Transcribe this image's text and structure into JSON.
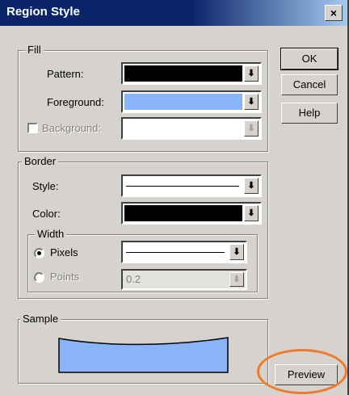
{
  "window": {
    "title": "Region Style",
    "close_glyph": "×"
  },
  "buttons": {
    "ok": "OK",
    "cancel": "Cancel",
    "help": "Help",
    "preview": "Preview"
  },
  "fill": {
    "group_label": "Fill",
    "pattern_label": "Pattern:",
    "pattern_color": "#000000",
    "foreground_label": "Foreground:",
    "foreground_color": "#8ab4f8",
    "background_label": "Background:",
    "background_checked": false,
    "background_color": "#ffffff"
  },
  "border": {
    "group_label": "Border",
    "style_label": "Style:",
    "color_label": "Color:",
    "color_value": "#000000",
    "width": {
      "group_label": "Width",
      "pixels_label": "Pixels",
      "points_label": "Points",
      "selected": "pixels",
      "points_value": "0.2"
    }
  },
  "sample": {
    "group_label": "Sample",
    "fill_color": "#8ab4f8"
  },
  "icons": {
    "dropdown_arrow": "⬇"
  },
  "colors": {
    "title_bar": "#0a246a",
    "dialog_bg": "#d6d3ce",
    "highlight": "#f07a2a"
  }
}
